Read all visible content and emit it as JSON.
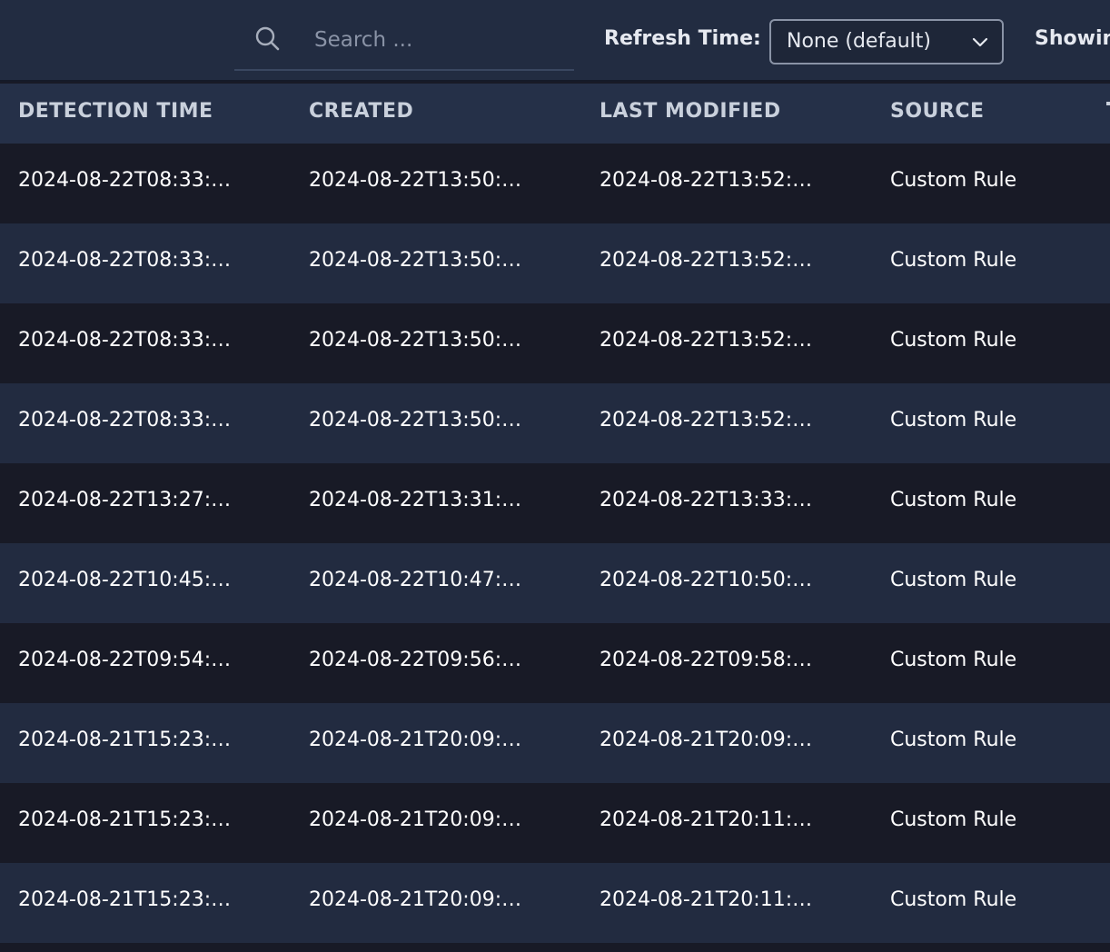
{
  "toolbar": {
    "search_placeholder": "Search ...",
    "refresh_label": "Refresh Time:",
    "refresh_value": "None (default)",
    "showing_label": "Showin"
  },
  "table": {
    "headers": [
      "DETECTION TIME",
      "CREATED",
      "LAST MODIFIED",
      "SOURCE"
    ],
    "rows": [
      [
        "2024-08-22T08:33:…",
        "2024-08-22T13:50:…",
        "2024-08-22T13:52:…",
        "Custom Rule"
      ],
      [
        "2024-08-22T08:33:…",
        "2024-08-22T13:50:…",
        "2024-08-22T13:52:…",
        "Custom Rule"
      ],
      [
        "2024-08-22T08:33:…",
        "2024-08-22T13:50:…",
        "2024-08-22T13:52:…",
        "Custom Rule"
      ],
      [
        "2024-08-22T08:33:…",
        "2024-08-22T13:50:…",
        "2024-08-22T13:52:…",
        "Custom Rule"
      ],
      [
        "2024-08-22T13:27:…",
        "2024-08-22T13:31:…",
        "2024-08-22T13:33:…",
        "Custom Rule"
      ],
      [
        "2024-08-22T10:45:…",
        "2024-08-22T10:47:…",
        "2024-08-22T10:50:…",
        "Custom Rule"
      ],
      [
        "2024-08-22T09:54:…",
        "2024-08-22T09:56:…",
        "2024-08-22T09:58:…",
        "Custom Rule"
      ],
      [
        "2024-08-21T15:23:…",
        "2024-08-21T20:09:…",
        "2024-08-21T20:09:…",
        "Custom Rule"
      ],
      [
        "2024-08-21T15:23:…",
        "2024-08-21T20:09:…",
        "2024-08-21T20:11:…",
        "Custom Rule"
      ],
      [
        "2024-08-21T15:23:…",
        "2024-08-21T20:09:…",
        "2024-08-21T20:11:…",
        "Custom Rule"
      ]
    ]
  },
  "colors": {
    "toolbar_bg": "#222c41",
    "header_bg": "#253048",
    "row_dark": "#181a26",
    "row_light": "#222b40",
    "text": "#ffffff",
    "muted": "#8a93a6"
  },
  "icons": {
    "search": "search-icon",
    "dropdown": "chevron-down-icon"
  }
}
